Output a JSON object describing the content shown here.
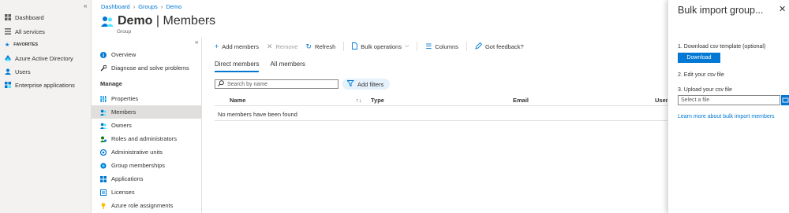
{
  "portal_nav": {
    "items": [
      {
        "label": "Dashboard",
        "icon": "dashboard-icon"
      },
      {
        "label": "All services",
        "icon": "list-icon"
      }
    ],
    "favorites_label": "FAVORITES",
    "favorites": [
      {
        "label": "Azure Active Directory",
        "icon": "azure-ad-icon"
      },
      {
        "label": "Users",
        "icon": "users-icon"
      },
      {
        "label": "Enterprise applications",
        "icon": "apps-grid-icon"
      }
    ]
  },
  "breadcrumb": [
    "Dashboard",
    "Groups",
    "Demo"
  ],
  "header": {
    "title_name": "Demo",
    "title_page": "Members",
    "subtitle": "Group",
    "more": "..."
  },
  "resource_menu": {
    "items_top": [
      {
        "label": "Overview",
        "icon": "info-icon"
      },
      {
        "label": "Diagnose and solve problems",
        "icon": "wrench-icon"
      }
    ],
    "section_label": "Manage",
    "items_manage": [
      {
        "label": "Properties",
        "icon": "properties-icon"
      },
      {
        "label": "Members",
        "icon": "members-icon"
      },
      {
        "label": "Owners",
        "icon": "owners-icon"
      },
      {
        "label": "Roles and administrators",
        "icon": "roles-icon"
      },
      {
        "label": "Administrative units",
        "icon": "admin-units-icon"
      },
      {
        "label": "Group memberships",
        "icon": "group-memberships-icon"
      },
      {
        "label": "Applications",
        "icon": "applications-icon"
      },
      {
        "label": "Licenses",
        "icon": "licenses-icon"
      },
      {
        "label": "Azure role assignments",
        "icon": "key-icon"
      }
    ]
  },
  "toolbar": {
    "add_members": "Add members",
    "remove": "Remove",
    "refresh": "Refresh",
    "bulk_operations": "Bulk operations",
    "columns": "Columns",
    "feedback": "Got feedback?"
  },
  "tabs": [
    "Direct members",
    "All members"
  ],
  "search": {
    "placeholder": "Search by name"
  },
  "filters": {
    "label": "Add filters"
  },
  "table": {
    "columns": [
      "Name",
      "Type",
      "Email",
      "User t"
    ],
    "empty_message": "No members have been found"
  },
  "blade": {
    "title": "Bulk import group...",
    "step1": "1. Download csv template (optional)",
    "download": "Download",
    "step2": "2. Edit your csv file",
    "step3": "3. Upload your csv file",
    "file_placeholder": "Select a file",
    "learn_more": "Learn more about bulk import members"
  },
  "colors": {
    "accent": "#0078d4",
    "nav_bg": "#f3f2f1",
    "selected_bg": "#e1dfdd"
  }
}
